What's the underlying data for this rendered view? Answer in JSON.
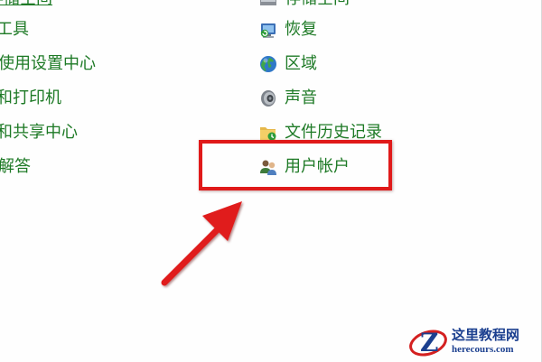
{
  "left_links": [
    {
      "label": "存储空间"
    },
    {
      "label": "工具"
    },
    {
      "label": "使用设置中心"
    },
    {
      "label": "和打印机"
    },
    {
      "label": "和共享中心"
    },
    {
      "label": "解答"
    }
  ],
  "right_links": [
    {
      "label": "存储空间",
      "icon": "storage-icon"
    },
    {
      "label": "恢复",
      "icon": "recovery-icon"
    },
    {
      "label": "区域",
      "icon": "region-globe-icon"
    },
    {
      "label": "声音",
      "icon": "speaker-icon"
    },
    {
      "label": "文件历史记录",
      "icon": "file-history-icon"
    },
    {
      "label": "用户帐户",
      "icon": "user-accounts-icon"
    }
  ],
  "annotation": {
    "highlight_color": "#e01a1a",
    "highlighted_item": "用户帐户"
  },
  "watermark": {
    "title": "这里教程网",
    "url": "herecours.com"
  },
  "colors": {
    "link": "#1e7a26",
    "watermark": "#1b3f8f"
  }
}
